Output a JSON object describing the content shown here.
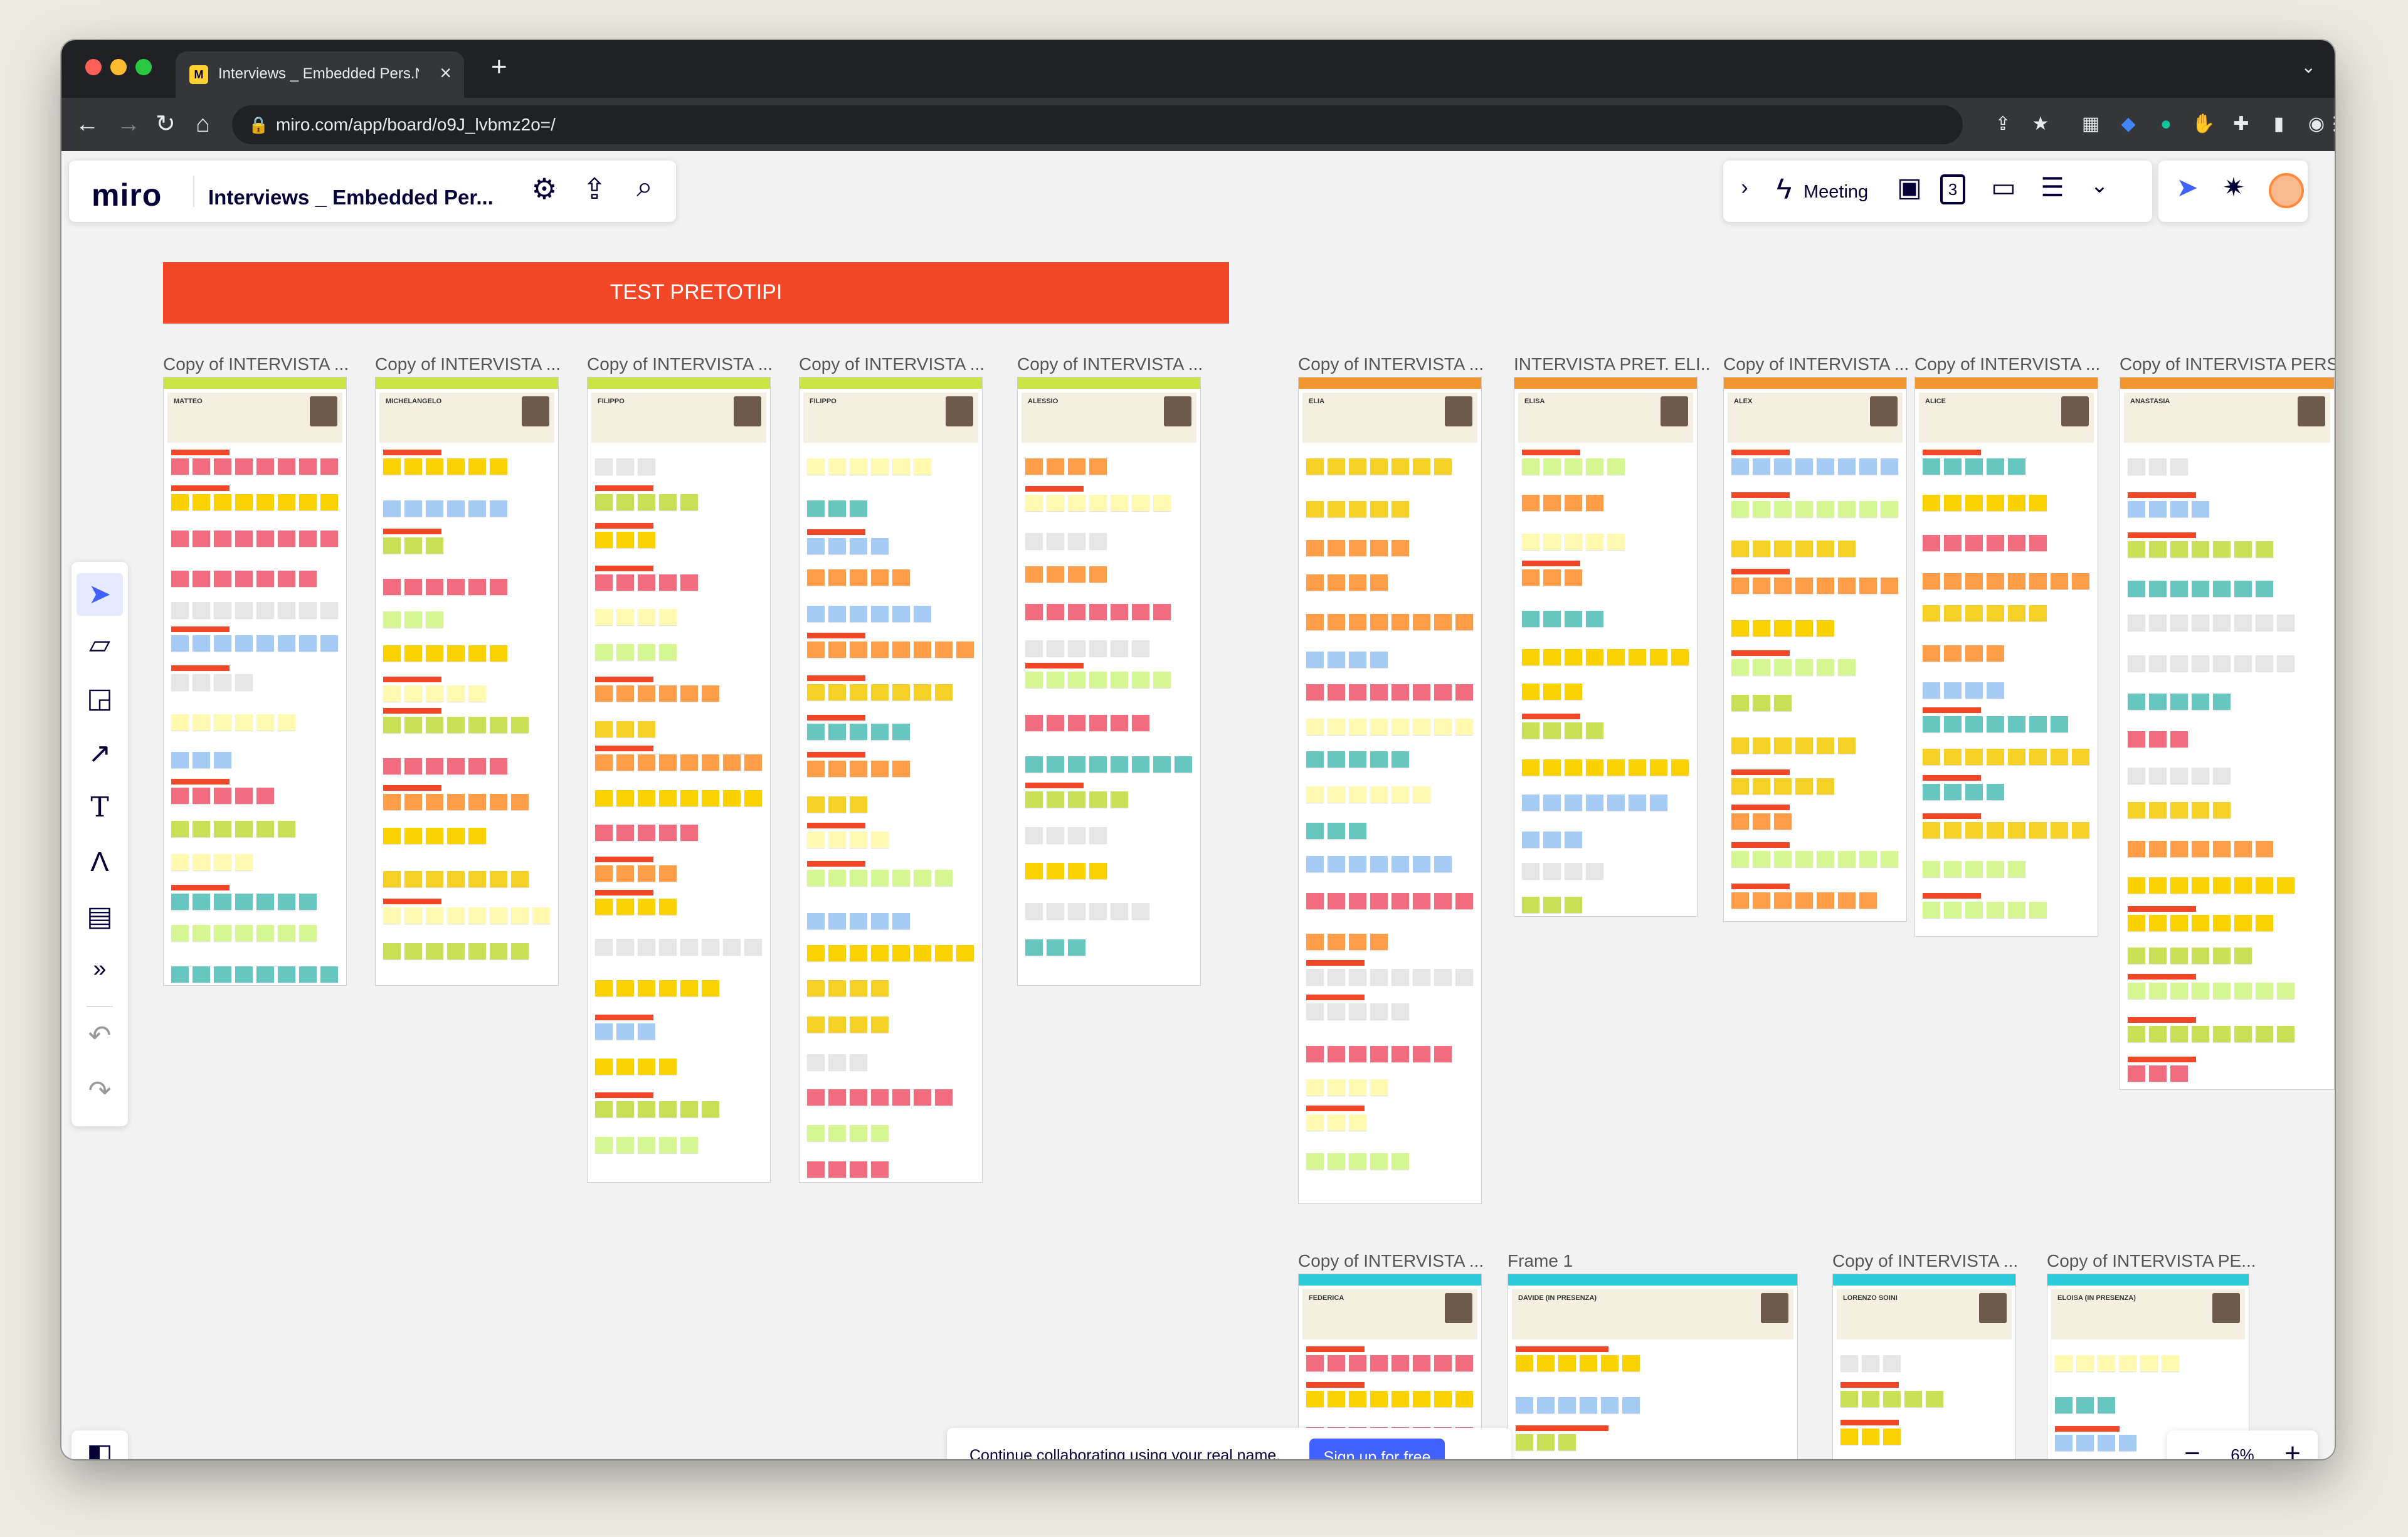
{
  "browser": {
    "tab_title": "Interviews _ Embedded Pers.N",
    "url": "miro.com/app/board/o9J_lvbmz2o=/",
    "new_tab": "+"
  },
  "miro": {
    "logo": "miro",
    "board_name": "Interviews _ Embedded Per...",
    "meeting_label": "Meeting",
    "timer_label": "3",
    "banner": "TEST PRETOTIPI",
    "frames_row1": [
      {
        "title": "Copy of INTERVISTA ...",
        "name": "MATTEO",
        "color": "#c9e445"
      },
      {
        "title": "Copy of INTERVISTA ...",
        "name": "MICHELANGELO",
        "color": "#c9e445"
      },
      {
        "title": "Copy of INTERVISTA ...",
        "name": "FILIPPO",
        "color": "#c9e445"
      },
      {
        "title": "Copy of INTERVISTA ...",
        "name": "FILIPPO",
        "color": "#c9e445"
      },
      {
        "title": "Copy of INTERVISTA ...",
        "name": "ALESSIO",
        "color": "#c9e445"
      },
      {
        "title": "Copy of INTERVISTA ...",
        "name": "ELIA",
        "color": "#f2962f"
      },
      {
        "title": "INTERVISTA PRET. ELI...",
        "name": "ELISA",
        "color": "#f2962f"
      },
      {
        "title": "Copy of INTERVISTA ...",
        "name": "ALEX",
        "color": "#f2962f"
      },
      {
        "title": "Copy of INTERVISTA ...",
        "name": "ALICE",
        "color": "#f2962f"
      },
      {
        "title": "Copy of INTERVISTA PERSO",
        "name": "ANASTASIA",
        "color": "#f2962f"
      }
    ],
    "frames_row2": [
      {
        "title": "Copy of INTERVISTA ...",
        "name": "FEDERICA",
        "color": "#2ccbdc"
      },
      {
        "title": "Frame 1",
        "name": "DAVIDE (IN PRESENZA)",
        "color": "#2ccbdc"
      },
      {
        "title": "Copy of INTERVISTA ...",
        "name": "LORENZO SOINI",
        "color": "#2ccbdc"
      },
      {
        "title": "Copy of INTERVISTA PE...",
        "name": "ELOISA (IN PRESENZA)",
        "color": "#2ccbdc"
      }
    ],
    "signup_text": "Continue collaborating using your real name.",
    "signup_button": "Sign up for free",
    "zoom_level": "6%",
    "zoom_out": "−",
    "zoom_in": "+"
  },
  "icons": [
    "settings-gear-icon",
    "share-upload-icon",
    "search-icon",
    "select-cursor-icon",
    "sticky-note-icon",
    "shapes-icon",
    "arrow-line-icon",
    "text-tool-icon",
    "pen-tool-icon",
    "comment-icon",
    "more-tools-icon",
    "undo-icon",
    "redo-icon",
    "board-list-icon"
  ]
}
